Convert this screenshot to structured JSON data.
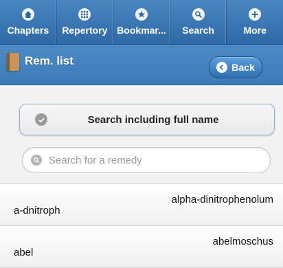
{
  "nav": {
    "tabs": [
      {
        "label": "Chapters",
        "icon": "home-icon"
      },
      {
        "label": "Repertory",
        "icon": "grid-icon"
      },
      {
        "label": "Bookmar...",
        "icon": "star-icon"
      },
      {
        "label": "Search",
        "icon": "search-icon"
      },
      {
        "label": "More",
        "icon": "plus-icon"
      }
    ]
  },
  "header": {
    "title": "Rem. list",
    "back_label": "Back"
  },
  "filters": {
    "toggle_label": "Search including full name"
  },
  "search": {
    "placeholder": "Search for a remedy",
    "value": ""
  },
  "list": {
    "items": [
      {
        "abbr": "a-dnitroph",
        "name": "alpha-dinitrophenolum"
      },
      {
        "abbr": "abel",
        "name": "abelmoschus"
      }
    ]
  },
  "colors": {
    "accent": "#3d7bb7",
    "text": "#111111"
  }
}
